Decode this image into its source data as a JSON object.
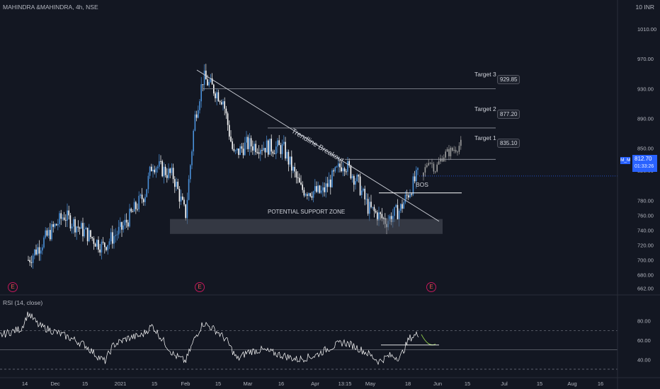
{
  "header": {
    "title": "MAHINDRA &MAHINDRA, 4h, NSE",
    "unit": "10 INR",
    "rsi_title": "RSI (14, close)"
  },
  "annotations": {
    "targets": [
      {
        "label": "Target 3",
        "value": "929.85"
      },
      {
        "label": "Target 2",
        "value": "877.20"
      },
      {
        "label": "Target 1",
        "value": "835.10"
      }
    ],
    "support_zone": "POTENTIAL SUPPORT ZONE",
    "trendline": "Trendline Breakout",
    "bos": "BOS",
    "earnings_marker": "E"
  },
  "price_tag": {
    "symbol": "M_M",
    "price": "812.70",
    "countdown": "01:33:26"
  },
  "colors": {
    "background": "#131722",
    "up": "#4a90d9",
    "down": "#ffffff",
    "projection": "#9e9e9e",
    "rsi": "#ffffff",
    "tag": "#2962ff"
  },
  "chart_data": {
    "type": "candlestick",
    "title": "MAHINDRA &MAHINDRA, 4h, NSE",
    "x_ticks": [
      "14",
      "Dec",
      "15",
      "2021",
      "15",
      "Feb",
      "15",
      "Mar",
      "16",
      "Apr",
      "13:15",
      "May",
      "18",
      "Jun",
      "15",
      "Jul",
      "15",
      "Aug",
      "16"
    ],
    "y_ticks": [
      1010,
      970,
      930,
      890,
      850,
      820,
      780,
      760,
      740,
      720,
      700,
      680,
      662
    ],
    "ylim": [
      655,
      1030
    ],
    "price_path": [
      [
        "14",
        700
      ],
      [
        "Dec",
        760
      ],
      [
        "15",
        718
      ],
      [
        "2021",
        742
      ],
      [
        "2021+",
        790
      ],
      [
        "15",
        830
      ],
      [
        "15+",
        812
      ],
      [
        "Feb",
        760
      ],
      [
        "Feb+",
        890
      ],
      [
        "Feb++",
        945
      ],
      [
        "15",
        915
      ],
      [
        "15+",
        840
      ],
      [
        "Mar",
        855
      ],
      [
        "16",
        850
      ],
      [
        "16+",
        795
      ],
      [
        "Apr",
        790
      ],
      [
        "Apr+",
        832
      ],
      [
        "13:15",
        805
      ],
      [
        "13:15+",
        770
      ],
      [
        "May",
        752
      ],
      [
        "May+",
        768
      ],
      [
        "18",
        818
      ]
    ],
    "projection": [
      "836",
      "822",
      "848",
      "856"
    ],
    "levels": {
      "target_3": 929.85,
      "target_2": 877.2,
      "target_1": 835.1,
      "bos": 790,
      "support_zone": [
        735,
        755
      ],
      "last_price": 812.7
    },
    "rsi": {
      "series": "RSI (14, close)",
      "y_ticks": [
        80.0,
        60.0,
        40.0
      ],
      "bands": [
        70,
        30
      ],
      "midline": 50,
      "drawn_level": 55
    }
  }
}
